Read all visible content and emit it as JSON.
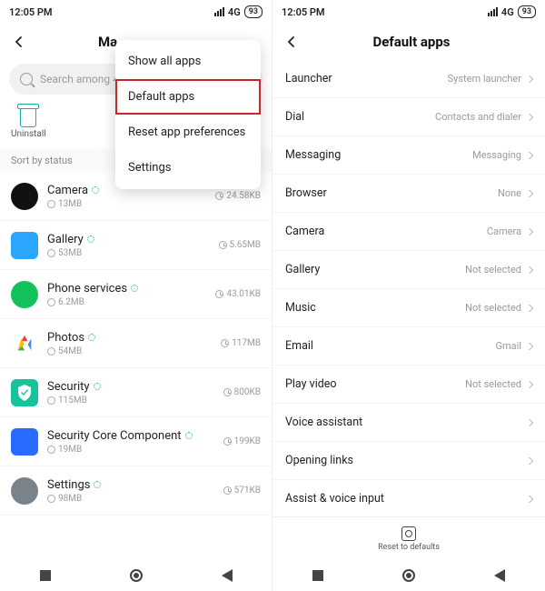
{
  "status": {
    "time": "12:05 PM",
    "net": "4G",
    "battery": "93"
  },
  "left": {
    "title": "Manage apps",
    "search_placeholder": "Search among 48 apps",
    "uninstall": "Uninstall",
    "sort_label": "Sort by status",
    "popup": [
      "Show all apps",
      "Default apps",
      "Reset app preferences",
      "Settings"
    ],
    "apps": [
      {
        "name": "Camera",
        "mem": "13MB",
        "size": "24.58KB",
        "color": "#111",
        "shape": "circle"
      },
      {
        "name": "Gallery",
        "mem": "53MB",
        "size": "5.65MB",
        "color": "#2aa6ff",
        "shape": "square"
      },
      {
        "name": "Phone services",
        "mem": "6.2MB",
        "size": "43.01KB",
        "color": "#13c15b",
        "shape": "circle"
      },
      {
        "name": "Photos",
        "mem": "54MB",
        "size": "117MB",
        "color": "#fff",
        "shape": "google"
      },
      {
        "name": "Security",
        "mem": "115MB",
        "size": "800KB",
        "color": "#17c39a",
        "shape": "shield"
      },
      {
        "name": "Security Core Component",
        "mem": "19MB",
        "size": "199KB",
        "color": "#2a6bff",
        "shape": "square"
      },
      {
        "name": "Settings",
        "mem": "98MB",
        "size": "571KB",
        "color": "#7a828a",
        "shape": "circle"
      }
    ]
  },
  "right": {
    "title": "Default apps",
    "rows": [
      {
        "label": "Launcher",
        "value": "System launcher"
      },
      {
        "label": "Dial",
        "value": "Contacts and dialer"
      },
      {
        "label": "Messaging",
        "value": "Messaging"
      },
      {
        "label": "Browser",
        "value": "None"
      },
      {
        "label": "Camera",
        "value": "Camera"
      },
      {
        "label": "Gallery",
        "value": "Not selected"
      },
      {
        "label": "Music",
        "value": "Not selected"
      },
      {
        "label": "Email",
        "value": "Gmail"
      },
      {
        "label": "Play video",
        "value": "Not selected"
      },
      {
        "label": "Voice assistant",
        "value": ""
      },
      {
        "label": "Opening links",
        "value": ""
      },
      {
        "label": "Assist & voice input",
        "value": ""
      }
    ],
    "reset": "Reset to defaults"
  }
}
